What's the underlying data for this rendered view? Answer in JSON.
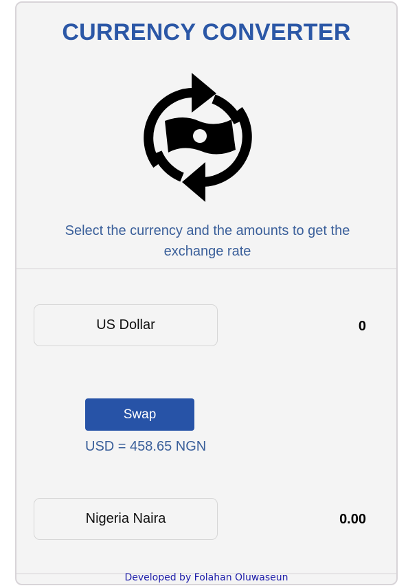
{
  "header": {
    "title": "CURRENCY CONVERTER",
    "logo_icon": "currency-exchange-icon",
    "subtitle": "Select the currency and the amounts to get the exchange rate"
  },
  "from": {
    "currency": "US Dollar",
    "amount": "0"
  },
  "swap": {
    "label": "Swap",
    "rate_text": "USD = 458.65 NGN"
  },
  "to": {
    "currency": "Nigeria Naira",
    "amount": "0.00"
  },
  "footer": {
    "credit": "Developed by Folahan Oluwaseun"
  },
  "colors": {
    "accent": "#2b57a6",
    "button": "#2753a7",
    "subtitle": "#3a5f9a",
    "footer_link": "#1a1aa8",
    "card_bg": "#f4f4f4"
  }
}
